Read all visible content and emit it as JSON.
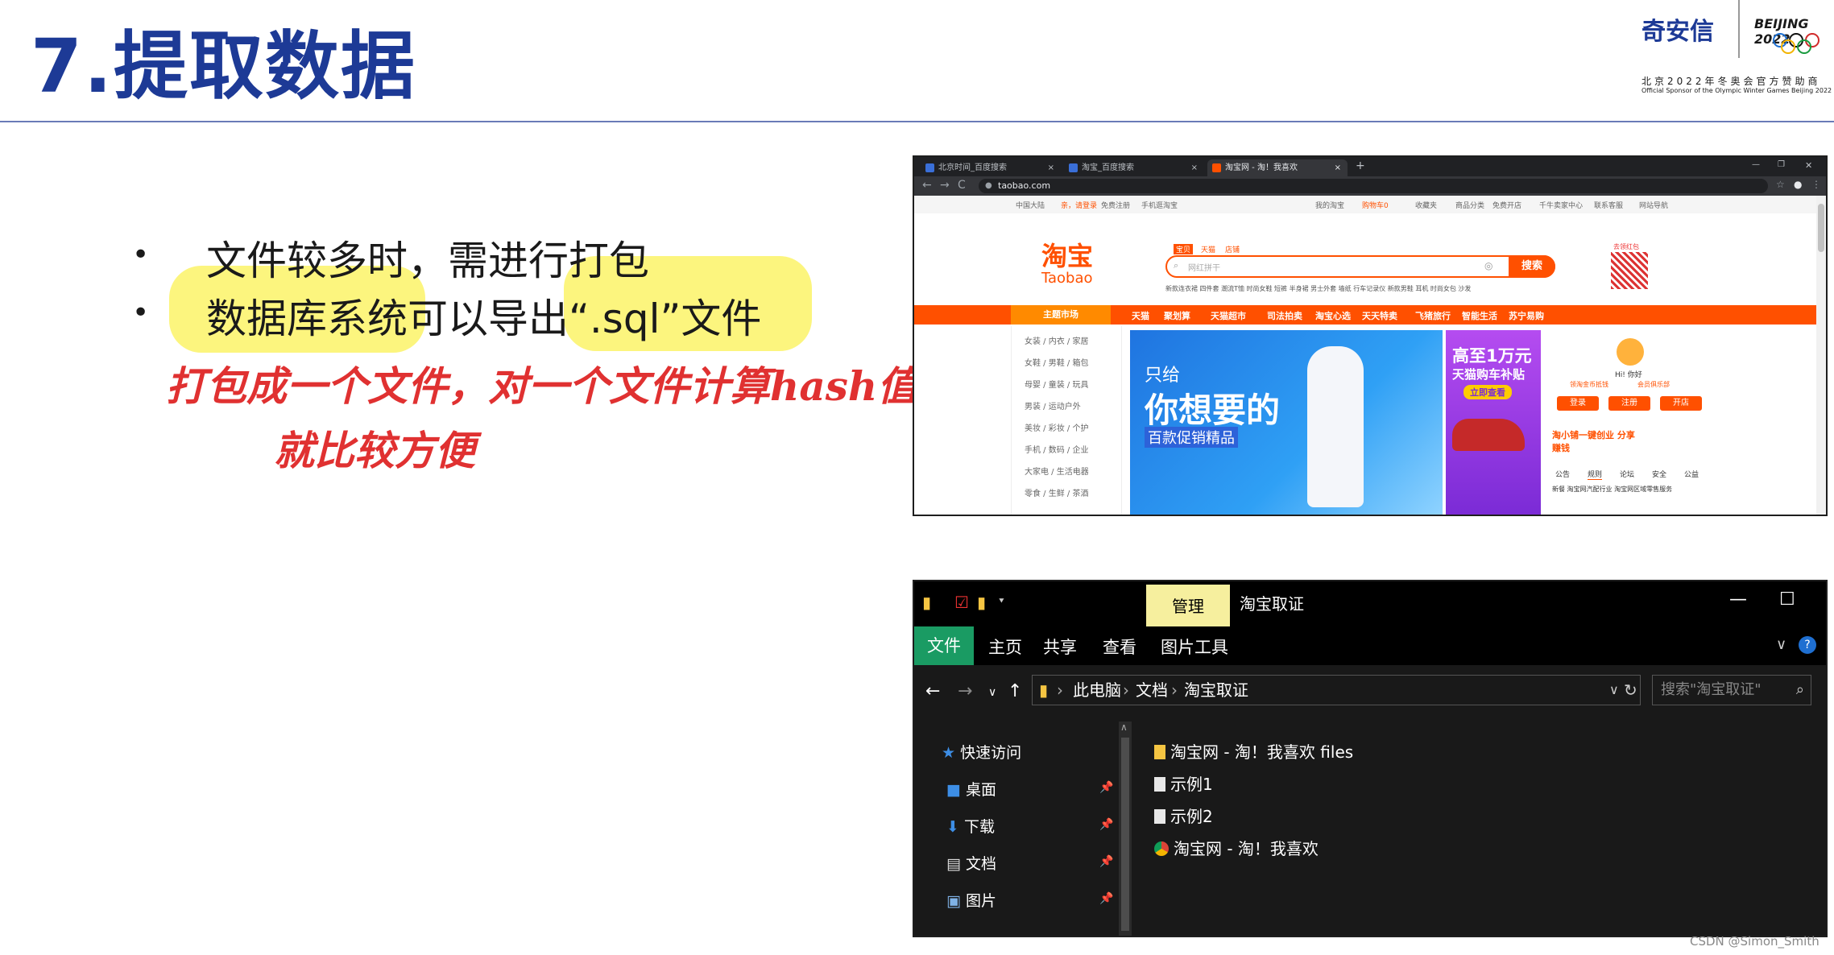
{
  "slide": {
    "title": "7.提取数据",
    "bullets": [
      "文件较多时，需进行打包",
      "数据库系统可以导出“.sql”文件"
    ],
    "handwriting": [
      "打包成一个文件，对一个文件计算hash值",
      "就比较方便"
    ],
    "credit": "CSDN @Simon_Smith"
  },
  "sponsor": {
    "name": "奇安信",
    "games": "BEIJING 2022",
    "cn": "北京2022年冬奥会官方赞助商",
    "en": "Official Sponsor of the Olympic Winter Games Beijing 2022"
  },
  "browser": {
    "tabs": [
      {
        "label": "北京时间_百度搜索",
        "close": "×"
      },
      {
        "label": "淘宝_百度搜索",
        "close": "×"
      },
      {
        "label": "淘宝网 - 淘！我喜欢",
        "close": "×"
      }
    ],
    "new_tab": "+",
    "window_controls": [
      "—",
      "❐",
      "✕"
    ],
    "nav": [
      "←",
      "→",
      "C"
    ],
    "url": "taobao.com",
    "toolbar_icons": [
      "☆",
      "●",
      "⋮"
    ],
    "site": {
      "top_links": [
        "中国大陆",
        "亲，请登录",
        "免费注册",
        "手机逛淘宝",
        "我的淘宝",
        "购物车0",
        "收藏夹",
        "商品分类",
        "免费开店",
        "千牛卖家中心",
        "联系客服",
        "网站导航"
      ],
      "logo_cn": "淘宝",
      "logo_en": "Taobao",
      "search_tabs": [
        "宝贝",
        "天猫",
        "店铺"
      ],
      "search_placeholder": "网红拼干",
      "search_button": "搜索",
      "hot_words": "新款连衣裙 四件套 潮流T恤 时尚女鞋 短裤 半身裙 男士外套 墙纸 行车记录仪 新款男鞋 耳机 时尚女包 沙发",
      "qr_label": "去领红包",
      "categories": [
        "主题市场",
        "天猫",
        "聚划算",
        "天猫超市",
        "司法拍卖",
        "淘宝心选",
        "天天特卖",
        "飞猪旅行",
        "智能生活",
        "苏宁易购"
      ],
      "side_menu": [
        "女装 / 内衣 / 家居",
        "女鞋 / 男鞋 / 箱包",
        "母婴 / 童装 / 玩具",
        "男装 / 运动户外",
        "美妆 / 彩妆 / 个护",
        "手机 / 数码 / 企业",
        "大家电 / 生活电器",
        "零食 / 生鲜 / 茶酒"
      ],
      "banner": {
        "line1": "只给",
        "line2": "你想要的",
        "line3": "百款促销精品"
      },
      "ad": {
        "line1": "高至1万元",
        "line2": "天猫购车补贴",
        "btn": "立即查看"
      },
      "user": {
        "greeting": "Hi! 你好",
        "perk1": "领淘金币抵钱",
        "perk2": "会员俱乐部",
        "login": "登录",
        "register": "注册",
        "open_shop": "开店",
        "promo": "淘小铺一键创业 分享赚钱",
        "notice_tabs": [
          "公告",
          "规则",
          "论坛",
          "安全",
          "公益"
        ],
        "notice": "新餐 淘宝网汽配行业 淘宝网区域零售服务"
      }
    }
  },
  "explorer": {
    "quick_icons": [
      "▮",
      "☑",
      "▮",
      "⯆"
    ],
    "manage_tab": "管理",
    "window_title": "淘宝取证",
    "window_controls": [
      "—",
      "☐",
      "✕"
    ],
    "ribbon": [
      "文件",
      "主页",
      "共享",
      "查看",
      "图片工具"
    ],
    "ribbon_collapse": "∨",
    "help": "?",
    "nav": [
      "←",
      "→",
      "∨",
      "↑"
    ],
    "breadcrumb": [
      "此电脑",
      "文档",
      "淘宝取证"
    ],
    "crumb_sep": "›",
    "crumb_tail": [
      "∨",
      "↻"
    ],
    "search_placeholder": "搜索\"淘宝取证\"",
    "search_icon": "⌕",
    "sidebar": [
      {
        "label": "快速访问",
        "pinned": false
      },
      {
        "label": "桌面",
        "pinned": true
      },
      {
        "label": "下载",
        "pinned": true
      },
      {
        "label": "文档",
        "pinned": true
      },
      {
        "label": "图片",
        "pinned": true
      }
    ],
    "pin_glyph": "📌",
    "scroll_up": "∧",
    "files": [
      "淘宝网 - 淘！我喜欢 files",
      "示例1",
      "示例2",
      "淘宝网 - 淘！我喜欢"
    ]
  },
  "colors": {
    "title": "#1d3a96",
    "highlight": "#fcf57e",
    "ink": "#e03131",
    "taobao": "#ff5000"
  }
}
